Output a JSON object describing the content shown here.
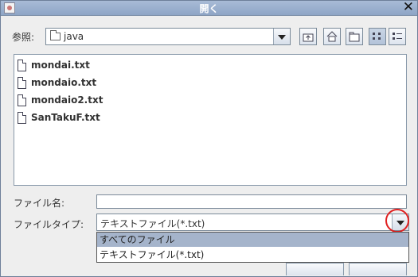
{
  "window": {
    "title": "開く"
  },
  "lookin": {
    "label": "参照:",
    "value": "java"
  },
  "files": [
    {
      "name": "mondai.txt"
    },
    {
      "name": "mondaio.txt"
    },
    {
      "name": "mondaio2.txt"
    },
    {
      "name": "SanTakuF.txt"
    }
  ],
  "filename": {
    "label": "ファイル名:",
    "value": ""
  },
  "filetype": {
    "label": "ファイルタイプ:",
    "value": "テキストファイル(*.txt)",
    "options": [
      "すべてのファイル",
      "テキストファイル(*.txt)"
    ]
  },
  "colors": {
    "titlebar": "#8ea5c6",
    "selected_option": "#a5b4cb",
    "highlight_circle": "#e02020"
  }
}
